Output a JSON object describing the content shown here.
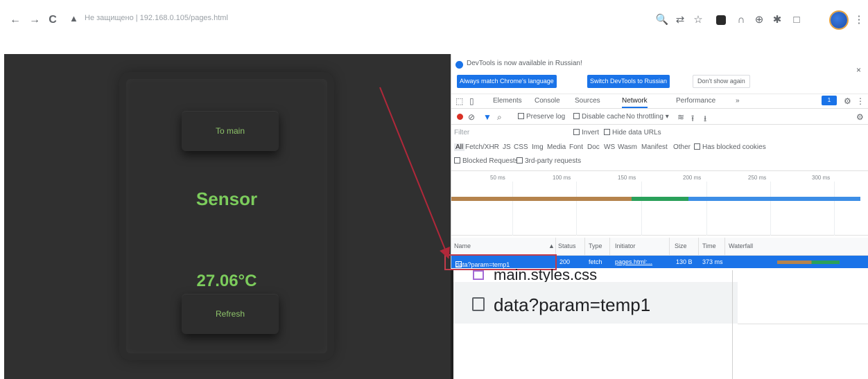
{
  "browser": {
    "back_icon": "←",
    "forward_icon": "→",
    "reload_icon": "C",
    "warn_icon": "▲",
    "address": "Не защищено | 192.168.0.105/pages.html",
    "ext_icons": [
      "🔍",
      "⇄",
      "☆",
      "■",
      "∩",
      "⊕",
      "✱",
      "□"
    ],
    "menu_icon": "⋮"
  },
  "webpage": {
    "to_main_label": "To main",
    "sensor_title": "Sensor",
    "sensor_value": "27.06°C",
    "refresh_label": "Refresh",
    "accent_color": "#7ccc5c"
  },
  "devtools": {
    "notice": "DevTools is now available in Russian!",
    "lang_btn_match": "Always match Chrome's language",
    "lang_btn_switch": "Switch DevTools to Russian",
    "lang_btn_dont": "Don't show again",
    "close_icon": "×",
    "tabs": [
      "Elements",
      "Console",
      "Sources",
      "Network",
      "Performance",
      "»"
    ],
    "active_tab": "Network",
    "badge": "1",
    "gear_icon": "⚙",
    "more_icon": "⋮",
    "dock_icon": "⤬",
    "controls": {
      "preserve_log": "Preserve log",
      "disable_cache": "Disable cache",
      "throttling": "No throttling ▾",
      "wifi_icon": "≋",
      "upload_icon": "⭱",
      "download_icon": "⭳",
      "settings_icon": "⚙"
    },
    "filter": {
      "placeholder": "Filter",
      "invert": "Invert",
      "hide_data_urls": "Hide data URLs",
      "types": [
        "All",
        "Fetch/XHR",
        "JS",
        "CSS",
        "Img",
        "Media",
        "Font",
        "Doc",
        "WS",
        "Wasm",
        "Manifest",
        "Other"
      ],
      "has_blocked_cookies": "Has blocked cookies",
      "blocked_requests": "Blocked Requests",
      "third_party": "3rd-party requests"
    },
    "timeline_ticks": [
      "50 ms",
      "100 ms",
      "150 ms",
      "200 ms",
      "250 ms",
      "300 ms"
    ],
    "columns": [
      "Name",
      "Status",
      "Type",
      "Initiator",
      "Size",
      "Time",
      "Waterfall"
    ],
    "request": {
      "name": "data?param=temp1",
      "status": "200",
      "type": "fetch",
      "initiator": "pages.html:...",
      "size": "130 B",
      "time": "373 ms"
    }
  },
  "zoom": {
    "prev_file": "main.styles.css",
    "file": "data?param=temp1"
  }
}
